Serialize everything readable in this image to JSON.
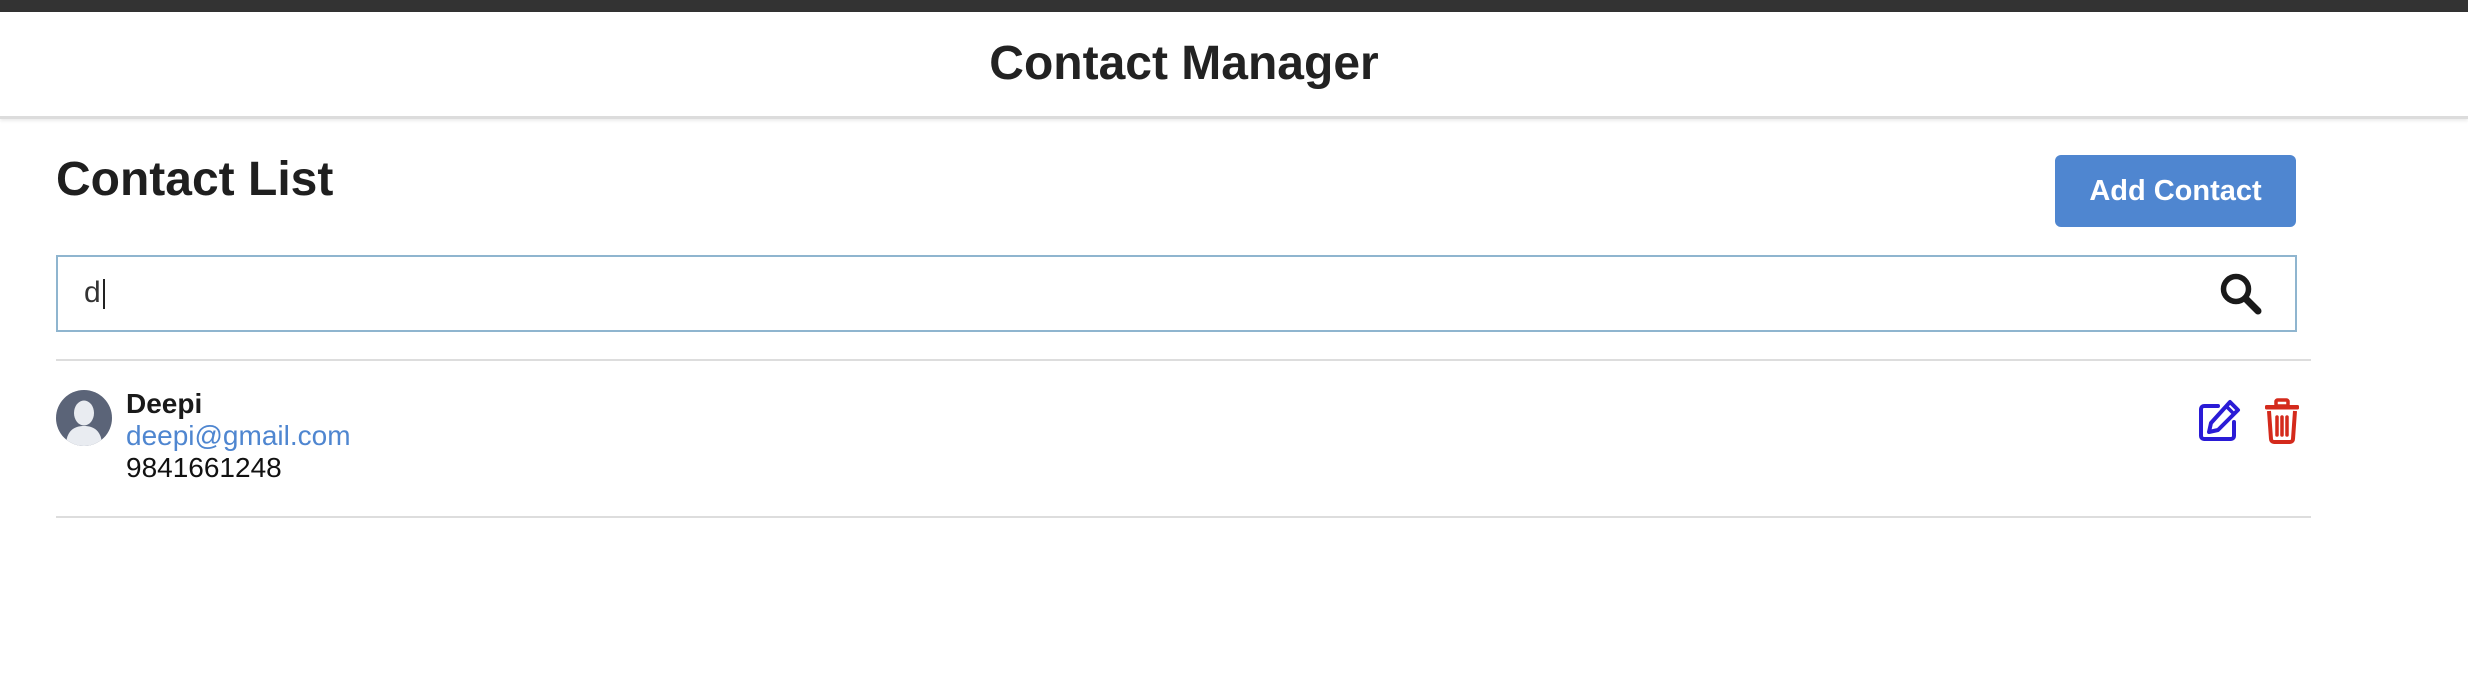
{
  "header": {
    "title": "Contact Manager"
  },
  "main": {
    "page_title": "Contact List",
    "add_button_label": "Add Contact",
    "search": {
      "value": "d",
      "placeholder": "",
      "icon": "search-icon"
    },
    "contacts": [
      {
        "name": "Deepi",
        "email": "deepi@gmail.com",
        "phone": "9841661248",
        "avatar_icon": "user-avatar-icon",
        "edit_icon": "edit-icon",
        "delete_icon": "trash-icon"
      }
    ]
  },
  "colors": {
    "accent": "#4f86d0",
    "edit": "#2a1bd6",
    "delete": "#d42a1c",
    "border": "#8fb5cf",
    "divider": "#dddddd",
    "top_strip": "#333333"
  }
}
